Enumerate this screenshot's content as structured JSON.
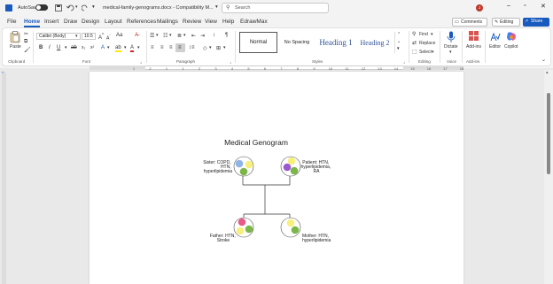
{
  "titlebar": {
    "autosave_label": "AutoSave",
    "autosave_state": "Off",
    "doc_title": "medical-family-genograms.docx  -  Compatibility M...",
    "search_placeholder": "Search",
    "user_initial": "J"
  },
  "menu": {
    "tabs": [
      "File",
      "Home",
      "Insert",
      "Draw",
      "Design",
      "Layout",
      "References",
      "Mailings",
      "Review",
      "View",
      "Help",
      "EdrawMax"
    ],
    "active": "Home"
  },
  "topright": {
    "comments": "Comments",
    "editing": "Editing",
    "share": "Share"
  },
  "ribbon": {
    "paste": "Paste",
    "font_name": "Calibri (Body)",
    "font_size": "10.5",
    "styles": [
      "Normal",
      "No Spacing",
      "Heading 1",
      "Heading 2"
    ],
    "find": "Find",
    "replace": "Replace",
    "select": "Select",
    "dictate": "Dictate",
    "addins": "Add-ins",
    "editor": "Editor",
    "copilot": "Copilot",
    "groups": {
      "clipboard": "Clipboard",
      "font": "Font",
      "paragraph": "Paragraph",
      "styles": "Styles",
      "editing": "Editing",
      "voice": "Voice",
      "addins": "Add-ins"
    },
    "ruler_numbers": [
      "1",
      "2",
      "1",
      "1",
      "2",
      "3",
      "4",
      "5",
      "6",
      "7",
      "8",
      "9",
      "10",
      "11",
      "12",
      "13",
      "14",
      "15",
      "16",
      "17",
      "18"
    ]
  },
  "document": {
    "title": "Medical Genogram",
    "sister_label": [
      "Sister: COPD,",
      "HTN,",
      "hyperlipidemia"
    ],
    "patient_label": [
      "Patient: HTN,",
      "hyperlipidemia,",
      "RA"
    ],
    "father_label": [
      "Father: HTN,",
      "Stroke"
    ],
    "mother_label": [
      "Mother: HTN,",
      "hyperlipidemia"
    ]
  },
  "colors": {
    "accent": "#185abd",
    "copd": "#8fb4e8",
    "htn": "#f7f07a",
    "hyperlipidemia": "#7ab648",
    "ra": "#9b59d0",
    "stroke": "#e85a8a"
  }
}
